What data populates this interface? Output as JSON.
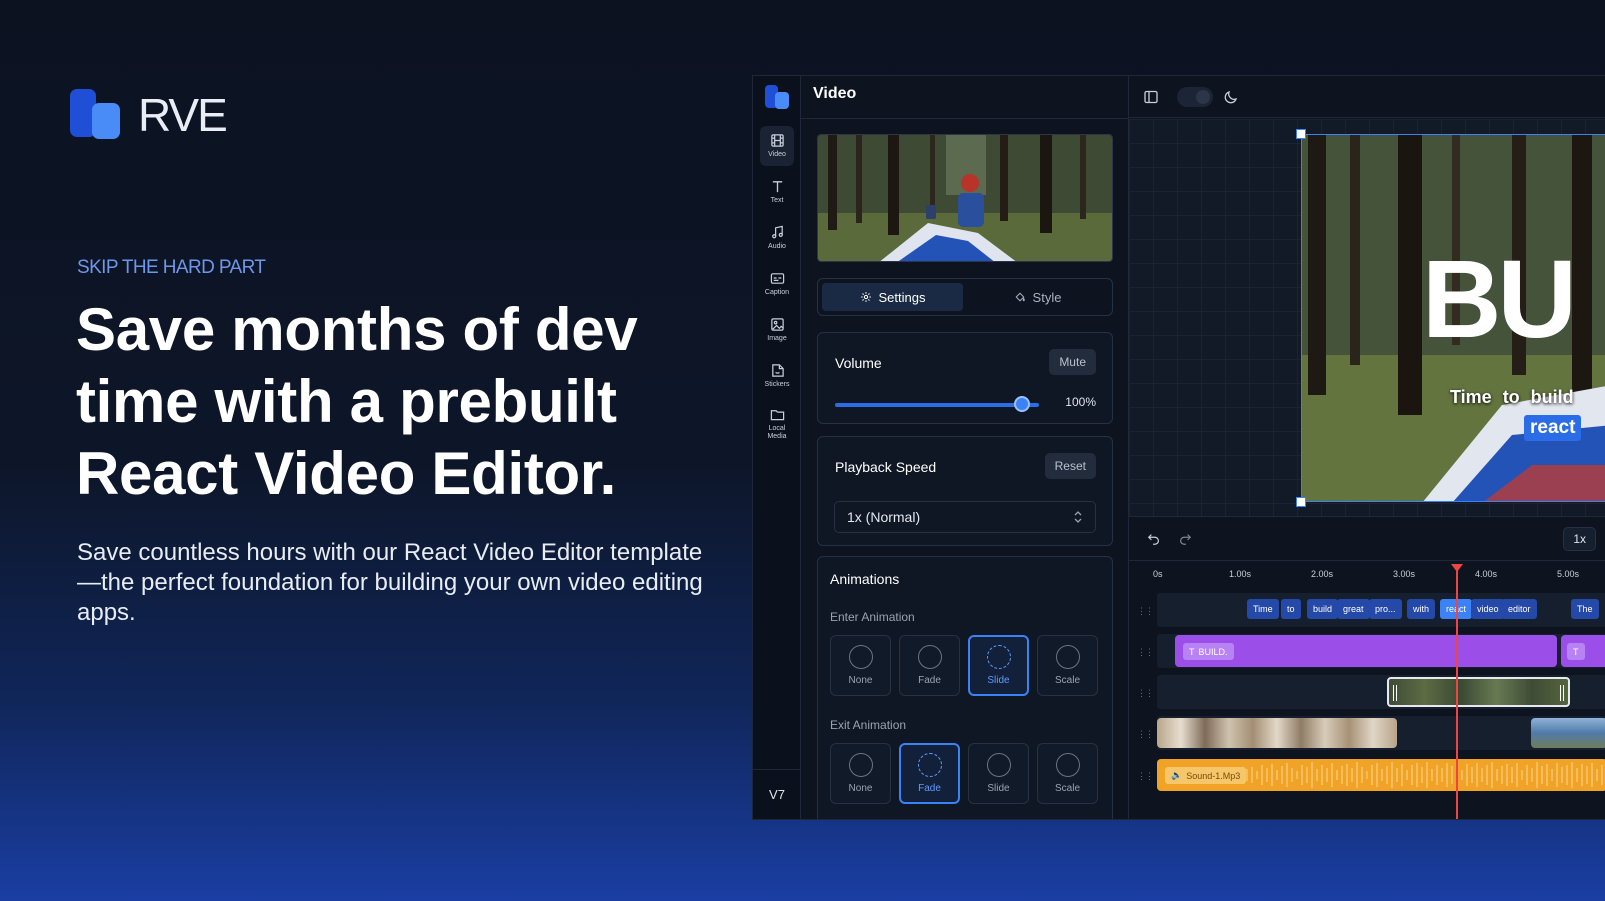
{
  "hero": {
    "logo_text": "RVE",
    "eyebrow": "SKIP THE HARD PART",
    "headline": "Save months of dev time with a prebuilt React Video Editor.",
    "subtext": "Save countless hours with our React Video Editor template—the perfect foundation for building your own video editing apps."
  },
  "sidebar": {
    "items": [
      {
        "label": "Video",
        "icon": "film-icon",
        "active": true
      },
      {
        "label": "Text",
        "icon": "text-icon"
      },
      {
        "label": "Audio",
        "icon": "music-icon"
      },
      {
        "label": "Caption",
        "icon": "caption-icon"
      },
      {
        "label": "Image",
        "icon": "image-icon"
      },
      {
        "label": "Stickers",
        "icon": "sticker-icon"
      },
      {
        "label": "Local Media",
        "icon": "folder-icon"
      }
    ],
    "version": "V7"
  },
  "panel": {
    "title": "Video",
    "tabs": [
      {
        "label": "Settings",
        "icon": "gear-icon"
      },
      {
        "label": "Style",
        "icon": "paint-bucket-icon"
      }
    ],
    "volume": {
      "label": "Volume",
      "button": "Mute",
      "value": "100%",
      "level": 1.0
    },
    "playback": {
      "label": "Playback Speed",
      "button": "Reset",
      "selected": "1x (Normal)"
    },
    "animations": {
      "title": "Animations",
      "enter_label": "Enter Animation",
      "enter_options": [
        "None",
        "Fade",
        "Slide",
        "Scale"
      ],
      "enter_selected": "Slide",
      "exit_label": "Exit Animation",
      "exit_options": [
        "None",
        "Fade",
        "Slide",
        "Scale"
      ],
      "exit_selected": "Fade"
    }
  },
  "preview": {
    "big_text": "BU",
    "caption_line": "Time to build",
    "caption_highlight": "react"
  },
  "timeline": {
    "speed": "1x",
    "ticks": [
      "0s",
      "1.00s",
      "2.00s",
      "3.00s",
      "4.00s",
      "5.00s"
    ],
    "caption_words": [
      "Time",
      "to",
      "build",
      "great",
      "pro...",
      "with",
      "react",
      "video",
      "editor",
      "The"
    ],
    "highlight_word": "react",
    "text_clip": "BUILD.",
    "text_clip_2": "T",
    "audio_clip": "Sound-1.Mp3"
  },
  "colors": {
    "accent": "#3b82f6",
    "text_clip": "#9b4ee8",
    "audio_clip": "#f0a326",
    "playhead": "#ef4444"
  }
}
